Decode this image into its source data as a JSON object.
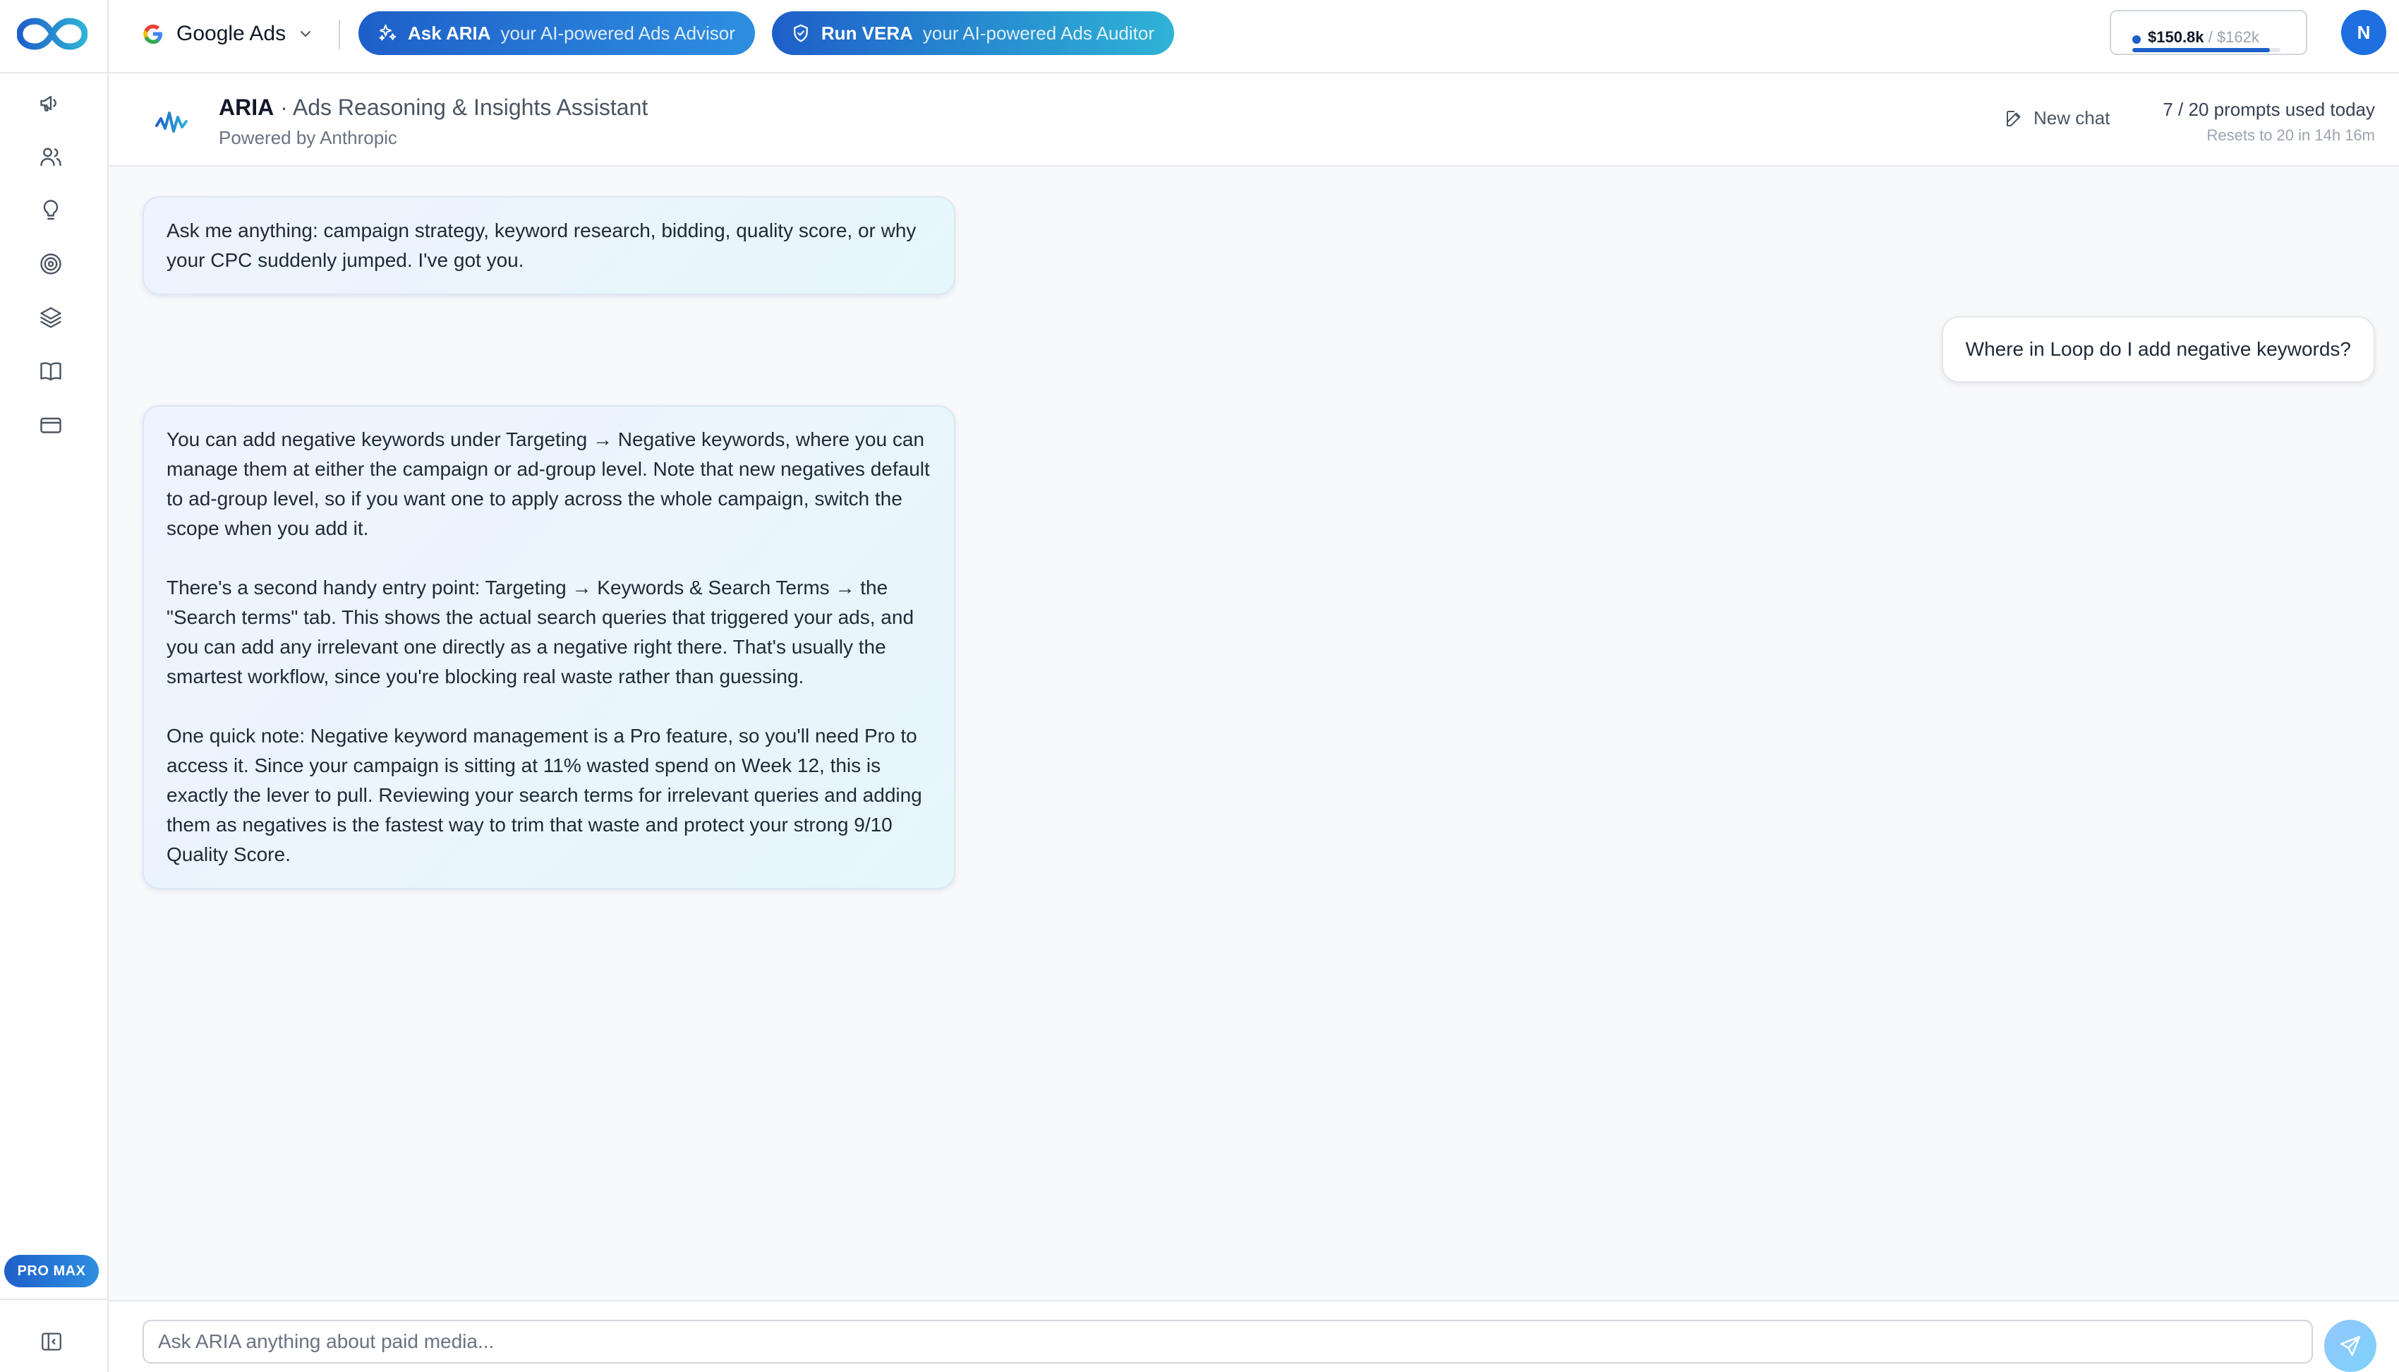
{
  "topbar": {
    "platform_label": "Google Ads",
    "aria_button": {
      "strong": "Ask ARIA",
      "sub": "your AI-powered Ads Advisor"
    },
    "vera_button": {
      "strong": "Run VERA",
      "sub": "your AI-powered Ads Auditor"
    },
    "budget": {
      "spent": "$150.8k",
      "slash": "/",
      "total": "$162k",
      "progress_fraction": 0.93
    },
    "avatar_initial": "N"
  },
  "sidebar": {
    "icons": [
      "megaphone-icon",
      "users-icon",
      "lightbulb-icon",
      "target-icon",
      "layers-icon",
      "book-icon",
      "credit-card-icon"
    ],
    "plan_badge": "PRO MAX"
  },
  "chat_header": {
    "assistant_name": "ARIA",
    "assistant_desc": "· Ads Reasoning & Insights Assistant",
    "powered_by": "Powered by Anthropic",
    "new_chat_label": "New chat",
    "usage_main": "7 / 20 prompts used today",
    "usage_sub": "Resets to 20 in 14h 16m"
  },
  "messages": [
    {
      "role": "assistant",
      "paragraphs": [
        "Ask me anything: campaign strategy, keyword research, bidding, quality score, or why your CPC suddenly jumped. I've got you."
      ]
    },
    {
      "role": "user",
      "paragraphs": [
        "Where in Loop do I add negative keywords?"
      ]
    },
    {
      "role": "assistant",
      "paragraphs": [
        "You can add negative keywords under Targeting → Negative keywords, where you can manage them at either the campaign or ad-group level. Note that new negatives default to ad-group level, so if you want one to apply across the whole campaign, switch the scope when you add it.",
        "There's a second handy entry point: Targeting → Keywords & Search Terms → the \"Search terms\" tab. This shows the actual search queries that triggered your ads, and you can add any irrelevant one directly as a negative right there. That's usually the smartest workflow, since you're blocking real waste rather than guessing.",
        "One quick note: Negative keyword management is a Pro feature, so you'll need Pro to access it. Since your campaign is sitting at 11% wasted spend on Week 12, this is exactly the lever to pull. Reviewing your search terms for irrelevant queries and adding them as negatives is the fastest way to trim that waste and protect your strong 9/10 Quality Score."
      ]
    }
  ],
  "input": {
    "placeholder": "Ask ARIA anything about paid media...",
    "value": ""
  },
  "colors": {
    "brand_blue": "#1e5fc9",
    "accent_cyan": "#2fb3d6",
    "background": "#f8f9fb"
  }
}
